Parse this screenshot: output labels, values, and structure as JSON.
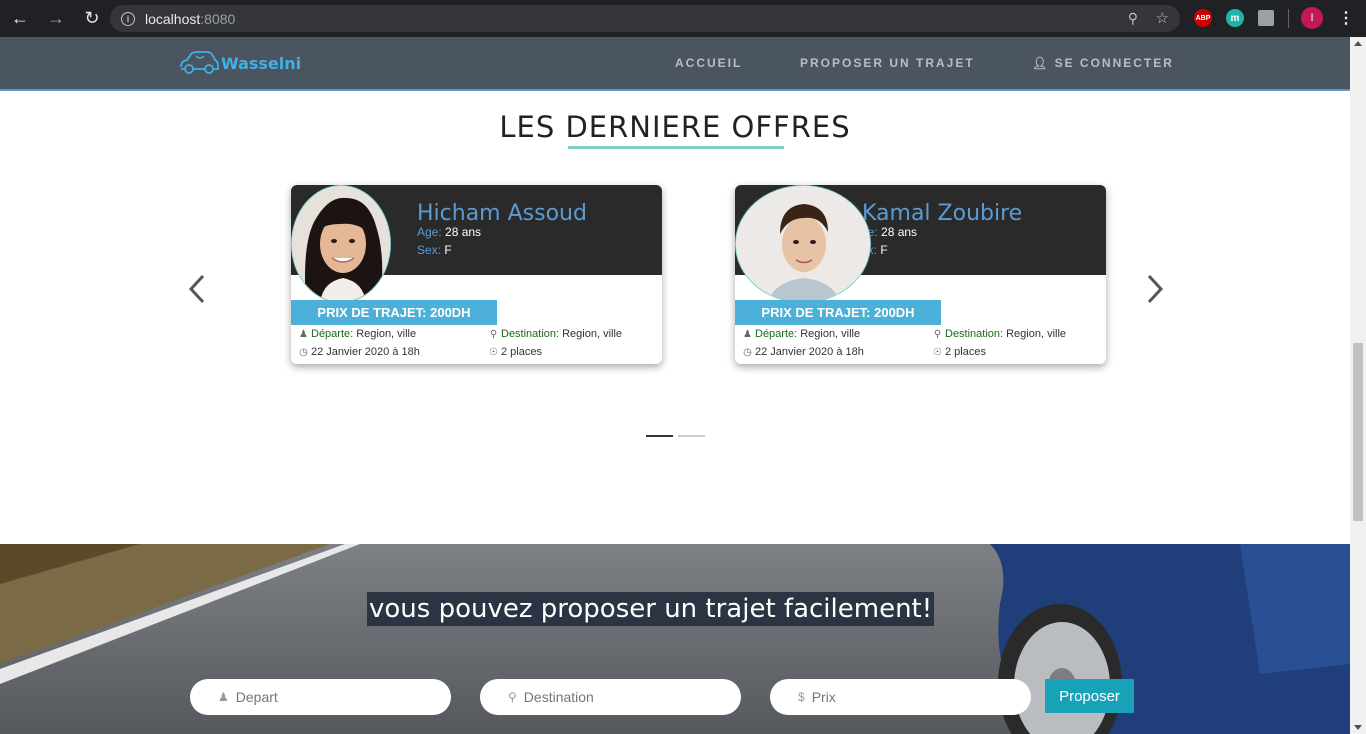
{
  "browser": {
    "url_host": "localhost",
    "url_port": ":8080",
    "extensions": {
      "abp": "ABP",
      "m": "m"
    },
    "profile_initial": "I"
  },
  "site": {
    "brand": "Wasselni",
    "nav": {
      "home": "ACCUEIL",
      "propose": "PROPOSER UN TRAJET",
      "login": "SE CONNECTER"
    }
  },
  "offers": {
    "title": "LES DERNIERE OFFRES",
    "labels": {
      "age": "Age:",
      "sex": "Sex:",
      "departure": "Départe:",
      "destination": "Destination:"
    },
    "cards": [
      {
        "name": "Hicham Assoud",
        "age": "28 ans",
        "sex": "F",
        "price": "PRIX DE TRAJET: 200DH",
        "departure": "Region, ville",
        "destination": "Region, ville",
        "date": "22 Janvier 2020 à 18h",
        "places": "2 places"
      },
      {
        "name": "Kamal Zoubire",
        "age": "28 ans",
        "sex": "F",
        "age_label_visible": "ge:",
        "sex_label_visible": "ex:",
        "price": "PRIX DE TRAJET: 200DH",
        "departure": "Region, ville",
        "destination": "Region, ville",
        "date": "22 Janvier 2020 à 18h",
        "places": "2 places"
      }
    ],
    "active_indicator": 1,
    "indicator_count": 2
  },
  "propose": {
    "headline": "vous pouvez proposer un trajet facilement!",
    "departure_placeholder": "Depart",
    "destination_placeholder": "Destination",
    "price_placeholder": "Prix",
    "submit_label": "Proposer"
  },
  "colors": {
    "navbar": "#4b5560",
    "accent_blue": "#5b9bd5",
    "price_badge": "#4db0d9",
    "title_underline": "#7ecfc8",
    "submit": "#17a2b8"
  }
}
